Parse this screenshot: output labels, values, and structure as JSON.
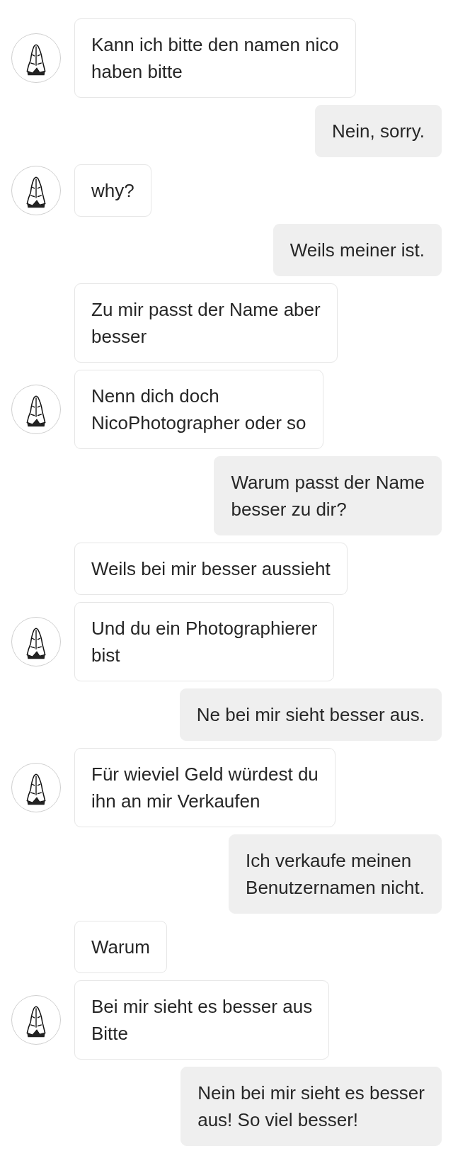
{
  "messages": [
    {
      "kind": "incoming",
      "avatar": true,
      "text": "Kann ich bitte den namen nico\nhaben bitte"
    },
    {
      "kind": "outgoing",
      "text": "Nein, sorry."
    },
    {
      "kind": "incoming",
      "avatar": true,
      "text": "why?"
    },
    {
      "kind": "outgoing",
      "text": "Weils meiner ist."
    },
    {
      "kind": "incoming",
      "avatar": false,
      "text": "Zu mir passt der Name aber\nbesser"
    },
    {
      "kind": "incoming",
      "avatar": true,
      "text": "Nenn dich doch\nNicoPhotographer oder so"
    },
    {
      "kind": "outgoing",
      "text": "Warum passt der Name\nbesser zu dir?"
    },
    {
      "kind": "incoming",
      "avatar": false,
      "text": "Weils bei mir besser aussieht"
    },
    {
      "kind": "incoming",
      "avatar": true,
      "text": "Und du ein Photographierer\nbist"
    },
    {
      "kind": "outgoing",
      "text": "Ne bei mir sieht besser aus."
    },
    {
      "kind": "incoming",
      "avatar": true,
      "text": "Für wieviel Geld würdest du\nihn an mir Verkaufen"
    },
    {
      "kind": "outgoing",
      "text": "Ich verkaufe meinen\nBenutzernamen nicht."
    },
    {
      "kind": "incoming",
      "avatar": false,
      "text": "Warum"
    },
    {
      "kind": "incoming",
      "avatar": true,
      "text": "Bei mir sieht es besser aus\nBitte"
    },
    {
      "kind": "outgoing",
      "text": "Nein bei mir sieht es besser\naus! So viel besser!"
    }
  ]
}
